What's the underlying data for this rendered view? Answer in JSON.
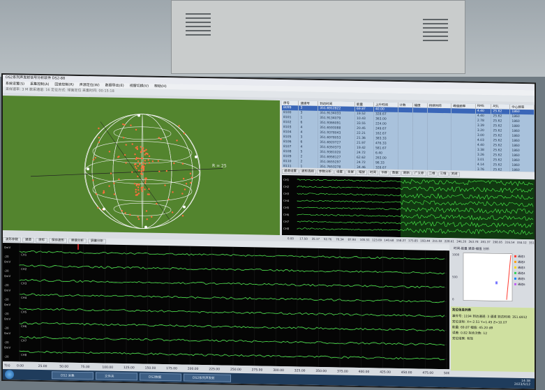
{
  "app": {
    "title": "DS2系列声发射信号分析软件 DS2-88"
  },
  "menu": [
    "系统设置(S)",
    "采集控制(A)",
    "回放控制(R)",
    "声源定位(W)",
    "数据导出(E)",
    "视窗切换(V)",
    "帮助(H)"
  ],
  "status_line": "采样速率: 3 M  数采通道: 16  定位方式: 球面定位  采集时间: 00:15:18",
  "location": {
    "axis_label": "R = 25"
  },
  "table": {
    "headers": [
      "序号",
      "通道号",
      "到达时间",
      "能量",
      "上升时间",
      "计数",
      "幅度",
      "持续时间",
      "峰值频率",
      "RMS",
      "ASL",
      "中心频率"
    ],
    "rows": [
      [
        "8099",
        "3",
        "351.6912822",
        "69.87",
        "40.00",
        "",
        "",
        "",
        "",
        "4.40",
        "25.62",
        "1860"
      ],
      [
        "8100",
        "3",
        "351.9134033",
        "19.52",
        "328.67",
        "",
        "",
        "",
        "",
        "4.40",
        "25.62",
        "1860"
      ],
      [
        "8101",
        "1",
        "351.9134079",
        "10.43",
        "363.00",
        "",
        "",
        "",
        "",
        "2.78",
        "25.62",
        "1860"
      ],
      [
        "8102",
        "6",
        "351.9366091",
        "33.55",
        "224.00",
        "",
        "",
        "",
        "",
        "3.39",
        "25.62",
        "1880"
      ],
      [
        "8103",
        "4",
        "351.6593088",
        "20.45",
        "249.67",
        "",
        "",
        "",
        "",
        "3.20",
        "25.62",
        "1860"
      ],
      [
        "8104",
        "4",
        "351.9378043",
        "22.21",
        "162.67",
        "",
        "",
        "",
        "",
        "3.00",
        "25.62",
        "1860"
      ],
      [
        "8105",
        "3",
        "351.6978053",
        "21.36",
        "383.33",
        "",
        "",
        "",
        "",
        "4.03",
        "25.62",
        "1860"
      ],
      [
        "8106",
        "6",
        "351.6920727",
        "21.97",
        "476.33",
        "",
        "",
        "",
        "",
        "4.40",
        "25.62",
        "1860"
      ],
      [
        "8107",
        "4",
        "351.6350373",
        "19.42",
        "581.67",
        "",
        "",
        "",
        "",
        "3.38",
        "25.62",
        "1860"
      ],
      [
        "8108",
        "5",
        "351.9381020",
        "24.72",
        "6.40",
        "",
        "",
        "",
        "",
        "3.26",
        "25.62",
        "1860"
      ],
      [
        "8109",
        "2",
        "351.6958127",
        "62.62",
        "263.00",
        "",
        "",
        "",
        "",
        "3.01",
        "25.62",
        "1860"
      ],
      [
        "8110",
        "2",
        "351.0655297",
        "24.72",
        "98.33",
        "",
        "",
        "",
        "",
        "4.14",
        "25.62",
        "1860"
      ],
      [
        "8111",
        "1",
        "351.7653278",
        "34.46",
        "328.67",
        "",
        "",
        "",
        "",
        "3.76",
        "25.62",
        "1860"
      ],
      [
        "8112",
        "1",
        "351.7563493",
        "19.51",
        "122.00",
        "",
        "",
        "",
        "",
        "3.65",
        "25.62",
        "1860"
      ]
    ]
  },
  "wave_toolbar": [
    "通道设置",
    "波形选择",
    "参数分析",
    "设置",
    "全屏",
    "缩放",
    "时间",
    "平移",
    "数据",
    "刷新",
    "广义参",
    "二维",
    "三维",
    "关闭"
  ],
  "small_axis_ticks": [
    "0.00",
    "17.50",
    "35.17",
    "52.76",
    "70.34",
    "87.93",
    "105.51",
    "123.09",
    "140.68",
    "158.27",
    "175.85",
    "193.44",
    "211.02",
    "228.61",
    "246.20",
    "263.78",
    "281.37",
    "298.95",
    "316.54",
    "334.12",
    "351.71"
  ],
  "bottom_toolbar": [
    "波形参数",
    "通道",
    "坐标",
    "保存波形",
    "频谱分析",
    "屏幕分析"
  ],
  "big_axis_unit": "T(s)",
  "big_axis_ticks": [
    "0.00",
    "25.00",
    "50.00",
    "75.00",
    "100.00",
    "125.00",
    "150.00",
    "175.00",
    "200.00",
    "225.00",
    "250.00",
    "275.00",
    "300.00",
    "325.00",
    "350.00",
    "375.00",
    "400.00",
    "425.00",
    "450.00",
    "475.00",
    "500.00"
  ],
  "big_channels": [
    "CH1",
    "CH2",
    "CH3",
    "CH4",
    "CH5",
    "CH6",
    "CH7",
    "CH8"
  ],
  "big_y_ticks": [
    "0mV",
    "20",
    "-20"
  ],
  "right_chart": {
    "title": "时间-能量 通道-幅值 分析",
    "y_ticks": [
      "1000",
      "500",
      "0"
    ],
    "legend": [
      "通道1",
      "通道2",
      "通道3",
      "通道4",
      "通道5",
      "通道6"
    ]
  },
  "info_panel": {
    "title": "定位信息列表",
    "lines": [
      "事件号: 1194  到达通道: 3 通道  到达时间: 351.6912",
      "定位坐标: X=-2.51 Y=1.45 Z=10.07",
      "能量: 69.87  幅值: 45.20 dB",
      "误差: 0.82  拟合次数: 12",
      "定位结果: 有效"
    ]
  },
  "taskbar": {
    "buttons": [
      "DS2 采集",
      "文件夹",
      "DS2数据",
      "DS2系列声发射"
    ],
    "time": "14:38",
    "date": "2023/5/12"
  }
}
